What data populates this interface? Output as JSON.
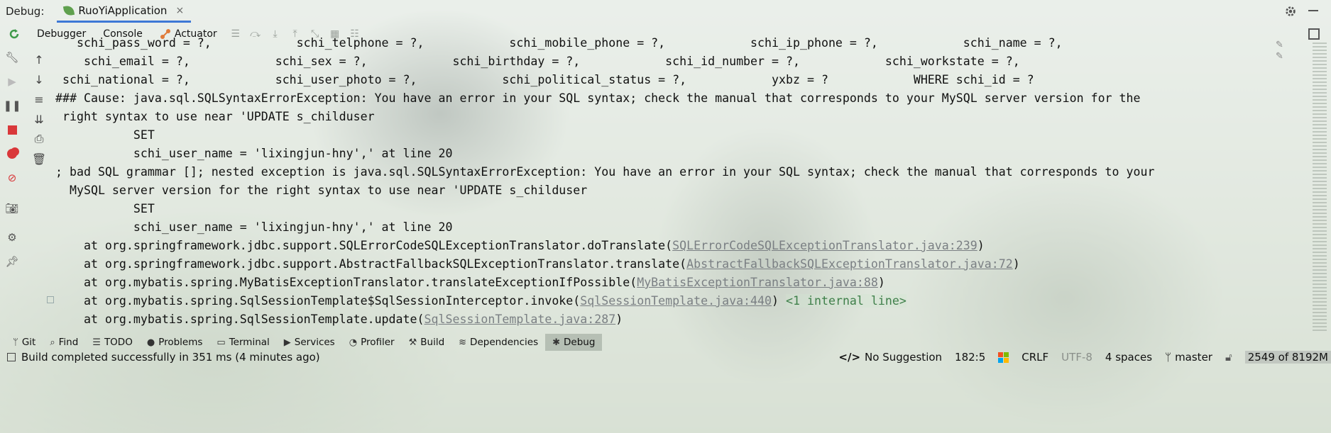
{
  "header": {
    "debug_label": "Debug:",
    "run_tab_label": "RuoYiApplication",
    "close_glyph": "×"
  },
  "toolbar": {
    "debugger_label": "Debugger",
    "console_label": "Console",
    "actuator_label": "Actuator"
  },
  "console": {
    "lines": [
      "   schi_pass_word = ?,            schi_telphone = ?,            schi_mobile_phone = ?,            schi_ip_phone = ?,            schi_name = ?,",
      "    schi_email = ?,            schi_sex = ?,            schi_birthday = ?,            schi_id_number = ?,            schi_workstate = ?,",
      " schi_national = ?,            schi_user_photo = ?,            schi_political_status = ?,            yxbz = ?            WHERE schi_id = ?",
      "### Cause: java.sql.SQLSyntaxErrorException: You have an error in your SQL syntax; check the manual that corresponds to your MySQL server version for the",
      " right syntax to use near 'UPDATE s_childuser",
      "           SET",
      "           schi_user_name = 'lixingjun-hny',' at line 20",
      "; bad SQL grammar []; nested exception is java.sql.SQLSyntaxErrorException: You have an error in your SQL syntax; check the manual that corresponds to your",
      "  MySQL server version for the right syntax to use near 'UPDATE s_childuser",
      "           SET",
      "           schi_user_name = 'lixingjun-hny',' at line 20"
    ],
    "stack": [
      {
        "prefix": "    at org.springframework.jdbc.support.SQLErrorCodeSQLExceptionTranslator.doTranslate(",
        "link": "SQLErrorCodeSQLExceptionTranslator.java:239",
        "suffix": ")"
      },
      {
        "prefix": "    at org.springframework.jdbc.support.AbstractFallbackSQLExceptionTranslator.translate(",
        "link": "AbstractFallbackSQLExceptionTranslator.java:72",
        "suffix": ")"
      },
      {
        "prefix": "    at org.mybatis.spring.MyBatisExceptionTranslator.translateExceptionIfPossible(",
        "link": "MyBatisExceptionTranslator.java:88",
        "suffix": ")"
      },
      {
        "prefix": "    at org.mybatis.spring.SqlSessionTemplate$SqlSessionInterceptor.invoke(",
        "link": "SqlSessionTemplate.java:440",
        "suffix": ") ",
        "extra": "<1 internal line>"
      },
      {
        "prefix": "    at org.mybatis.spring.SqlSessionTemplate.update(",
        "link": "SqlSessionTemplate.java:287",
        "suffix": ")"
      }
    ]
  },
  "bottom_tabs": [
    {
      "label": "Git",
      "icon": "git-branch-icon",
      "glyph": "ᛘ"
    },
    {
      "label": "Find",
      "icon": "search-icon",
      "glyph": "⌕"
    },
    {
      "label": "TODO",
      "icon": "list-icon",
      "glyph": "☰"
    },
    {
      "label": "Problems",
      "icon": "info-icon",
      "glyph": "●"
    },
    {
      "label": "Terminal",
      "icon": "terminal-icon",
      "glyph": "▭"
    },
    {
      "label": "Services",
      "icon": "play-icon",
      "glyph": "▶"
    },
    {
      "label": "Profiler",
      "icon": "profiler-icon",
      "glyph": "◔"
    },
    {
      "label": "Build",
      "icon": "hammer-icon",
      "glyph": "⚒"
    },
    {
      "label": "Dependencies",
      "icon": "layers-icon",
      "glyph": "≋"
    },
    {
      "label": "Debug",
      "icon": "bug-icon",
      "glyph": "✱"
    }
  ],
  "status": {
    "build_message": "Build completed successfully in 351 ms (4 minutes ago)",
    "suggestion": "No Suggestion",
    "position": "182:5",
    "line_ending": "CRLF",
    "encoding": "UTF-8",
    "indent": "4 spaces",
    "branch": "master",
    "memory": "2549 of 8192M"
  },
  "colors": {
    "accent": "#3d78d6",
    "link": "#7a7f83",
    "internal_line": "#3f7f4a",
    "stop_red": "#d9383a"
  }
}
